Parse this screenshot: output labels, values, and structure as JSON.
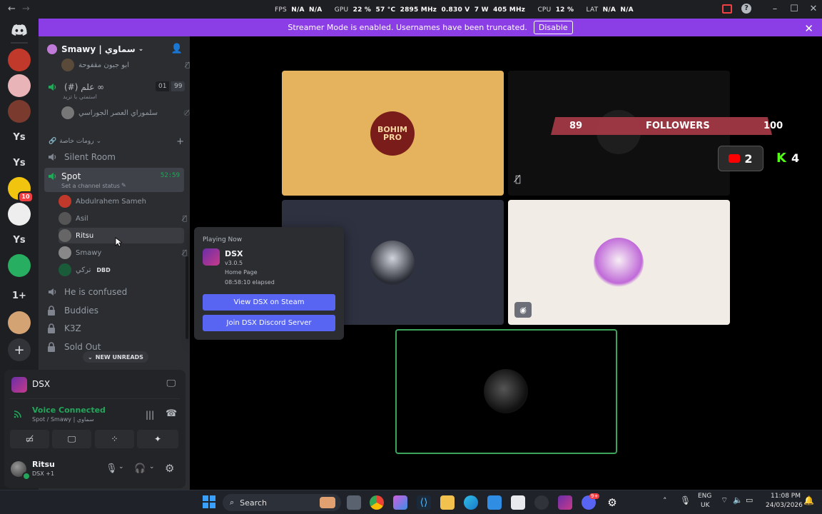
{
  "titlebar": {
    "title": "Smawy | سماوي",
    "back_glyph": "←",
    "forward_glyph": "→",
    "overlay": {
      "fps_label": "FPS",
      "fps_value": "N/A",
      "fps_value2": "N/A",
      "gpu_label": "GPU",
      "gpu_usage": "22 %",
      "gpu_temp": "57 °C",
      "gpu_clock": "2895 MHz",
      "gpu_other": "0.830 V",
      "gpu_mem": "7 W",
      "gpu_mem_clock": "405 MHz",
      "cpu_label": "CPU",
      "cpu_usage": "12 %",
      "lat_label": "LAT",
      "lat_value": "N/A",
      "lat_value2": "N/A"
    }
  },
  "banner": {
    "text": "Streamer Mode is enabled. Usernames have been truncated.",
    "button": "Disable"
  },
  "rail": {
    "servers": [
      {
        "type": "image",
        "name": "boohimpro-server",
        "color": "#c0392b"
      },
      {
        "type": "image",
        "name": "anime-server",
        "color": "#e8b4b8"
      },
      {
        "type": "image",
        "name": "avatar-server",
        "color": "#7a3b2e"
      },
      {
        "type": "text",
        "label": "Ys"
      },
      {
        "type": "text",
        "label": "Ys"
      },
      {
        "type": "image",
        "name": "cartoon-server",
        "color": "#f1c40f",
        "badge": "10"
      },
      {
        "type": "image",
        "name": "sketch-server",
        "color": "#eeeeee"
      },
      {
        "type": "text",
        "label": "Ys"
      },
      {
        "type": "image",
        "name": "green-server",
        "color": "#27ae60"
      },
      {
        "type": "text",
        "label": "1+"
      },
      {
        "type": "image",
        "name": "food-server",
        "color": "#d4a373"
      }
    ]
  },
  "sidebar": {
    "server_name": "Smawy | سماوي",
    "top_items": [
      {
        "label": "ابو جبون مقفوحة",
        "kind": "user"
      },
      {
        "label": "(#) علم ∞",
        "status": "استمتي با تزيد",
        "count_a": "01",
        "count_b": "99",
        "kind": "voice"
      },
      {
        "label": "سلموراي العصر الجوراسي",
        "kind": "user"
      }
    ],
    "category": "رومات خاصة",
    "channels": [
      {
        "label": "Silent Room",
        "kind": "voice"
      },
      {
        "label": "Spot",
        "kind": "voice-active",
        "status": "Set a channel status",
        "timer": "52:59"
      }
    ],
    "spot_users": [
      {
        "name": "Abdulrahem Sameh",
        "color": "#c0392b"
      },
      {
        "name": "Asil",
        "color": "#555"
      },
      {
        "name": "Ritsu",
        "color": "#666"
      },
      {
        "name": "Smawy",
        "color": "#888"
      },
      {
        "name": "تركي",
        "activity": "DBD",
        "color": "#1a5c3a"
      }
    ],
    "more_channels": [
      {
        "label": "He is confused",
        "kind": "voice"
      },
      {
        "label": "Buddies",
        "kind": "locked"
      },
      {
        "label": "K3Z",
        "kind": "locked"
      },
      {
        "label": "Sold Out",
        "kind": "locked"
      }
    ],
    "new_unreads": "NEW UNREADS"
  },
  "popup": {
    "heading": "Playing Now",
    "game": "DSX",
    "version": "v3.0.5",
    "state": "Home Page",
    "elapsed": "08:58:10 elapsed",
    "btn_steam": "View DSX on Steam",
    "btn_discord": "Join DSX Discord Server"
  },
  "panel": {
    "activity_name": "DSX",
    "voice_status": "Voice Connected",
    "voice_channel": "Spot / Smawy | سماوي",
    "username": "Ritsu",
    "user_activity": "DSX +1",
    "colors": {
      "voice_green": "#23a55a"
    }
  },
  "main": {
    "followers_left": "89",
    "followers_label": "FOLLOWERS",
    "followers_right": "100",
    "youtube_count": "2",
    "kick_count": "4",
    "logo_text": "BOHIM PRO",
    "colors": {
      "tile_yellow": "#e5b35e",
      "tile_slate": "#2e3140",
      "tile_cream": "#f1ede6",
      "speaking_green": "#3ba55c",
      "banner_red": "#a63a45"
    }
  },
  "taskbar": {
    "search_label": "Search",
    "lang_top": "ENG",
    "lang_bottom": "UK",
    "time": "11:08 PM",
    "date": "24/03/2026",
    "discord_badge": "9+"
  }
}
